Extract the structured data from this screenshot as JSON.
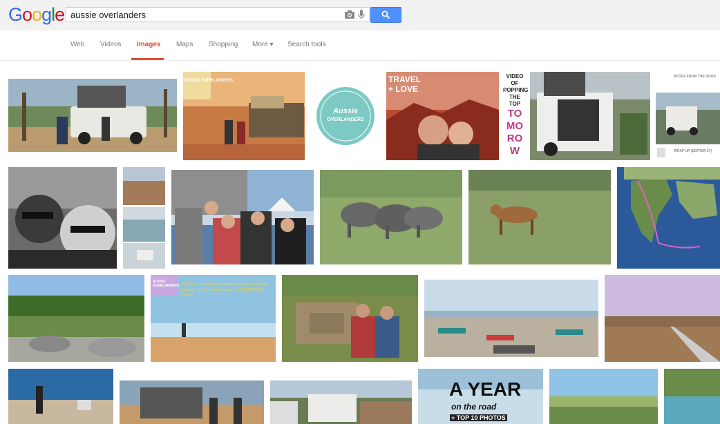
{
  "logo": {
    "letters": [
      "G",
      "o",
      "o",
      "g",
      "l",
      "e"
    ],
    "colors": [
      "#3369e8",
      "#d50f25",
      "#eeb211",
      "#3369e8",
      "#009925",
      "#d50f25"
    ]
  },
  "search": {
    "query": "aussie overlanders"
  },
  "icons": {
    "camera": "camera-icon",
    "mic": "microphone-icon",
    "search": "search-icon"
  },
  "tabs": [
    {
      "label": "Web"
    },
    {
      "label": "Videos"
    },
    {
      "label": "Images",
      "active": true
    },
    {
      "label": "Maps"
    },
    {
      "label": "Shopping"
    },
    {
      "label": "More ▾"
    },
    {
      "label": "Search tools"
    }
  ],
  "accent": "#dd4b39",
  "thumbs": {
    "logo_text_1": "Aussie",
    "logo_text_2": "OVERLANDERS",
    "travel_love_1": "TRAVEL",
    "travel_love_2": "+ LOVE",
    "video_text": "VIDEO OF POPPING THE TOP",
    "tomorrow": "TO MO RO W",
    "notes_title": "NOTES FROM THE ROAD",
    "wrap_up": "WRAP UP (EDITION 27)",
    "aussie_overlanders_tag": "AUSSIE OVERLANDERS",
    "travel_quote": "TRAVEL is more than the seeing of sights; it is a change that goes on, deep and permanent, in THE IDEAS OF LIVING",
    "year_on_road_1": "A YEAR",
    "year_on_road_2": "on the road",
    "year_on_road_3": "+ TOP 10 PHOTOS"
  }
}
